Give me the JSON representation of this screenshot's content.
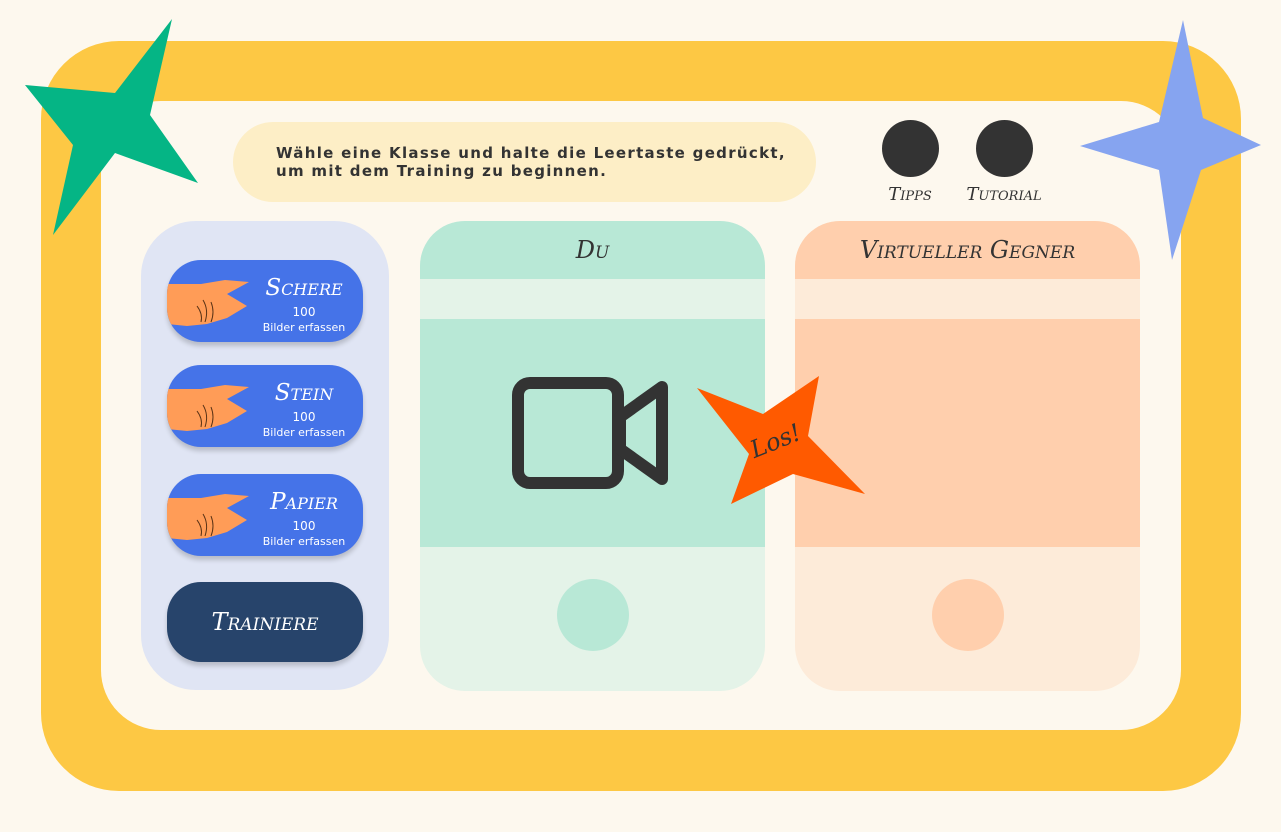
{
  "instruction": {
    "line1": "Wähle eine Klasse und halte die Leertaste gedrückt,",
    "line2": "um mit dem Training zu beginnen."
  },
  "top_buttons": [
    {
      "label": "Tipps",
      "icon": "circle-button"
    },
    {
      "label": "Tutorial",
      "icon": "circle-button"
    }
  ],
  "classes": [
    {
      "name": "Schere",
      "count": "100",
      "sub": "Bilder erfassen",
      "icon": "hand-icon"
    },
    {
      "name": "Stein",
      "count": "100",
      "sub": "Bilder erfassen",
      "icon": "hand-icon"
    },
    {
      "name": "Papier",
      "count": "100",
      "sub": "Bilder erfassen",
      "icon": "hand-icon"
    }
  ],
  "train_button": "Trainiere",
  "player_panel": {
    "title": "Du",
    "icon": "video-camera-icon"
  },
  "opponent_panel": {
    "title": "Virtueller Gegner"
  },
  "start_burst": {
    "label": "Los!"
  },
  "colors": {
    "frame": "#fdc844",
    "background": "#fdf8ee",
    "class_button": "#4573e8",
    "train_button": "#27446b",
    "player_accent": "#b8e8d6",
    "opponent_accent": "#ffcfad",
    "start_burst": "#ff5a00",
    "star_green": "#05b585",
    "star_blue": "#86a4f0"
  }
}
